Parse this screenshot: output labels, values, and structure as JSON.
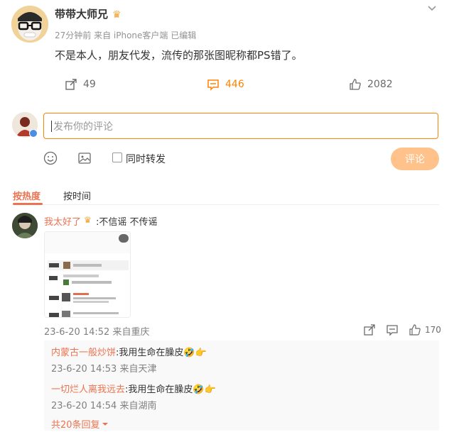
{
  "post": {
    "author": "带带大师兄",
    "author_badge": "♛",
    "meta": "27分钟前 来自 iPhone客户端 已编辑",
    "text": "不是本人，朋友代发，流传的那张图昵称都PS错了。",
    "reposts": "49",
    "comments": "446",
    "likes": "2082"
  },
  "compose": {
    "placeholder": "发布你的评论",
    "repost_label": "同时转发",
    "submit_label": "评论"
  },
  "sort_tabs": {
    "hot": "按热度",
    "time": "按时间"
  },
  "comment": {
    "user": "我太好了",
    "badge": "♛",
    "text": ":不信谣 不传谣",
    "meta": "23-6-20 14:52 来自重庆",
    "likes": "170"
  },
  "replies": [
    {
      "user": "内蒙古一般炒饼",
      "text": ":我用生命在臊皮🤣👉",
      "meta": "23-6-20 14:53 来自天津"
    },
    {
      "user": "一切烂人离我远去",
      "text": ":我用生命在臊皮🤣👉",
      "meta": "23-6-20 14:54 来自湖南"
    }
  ],
  "more_replies": "共20条回复",
  "colors": {
    "accent": "#ff8200",
    "name": "#eb7350",
    "submit_disabled": "#ffc28a"
  }
}
